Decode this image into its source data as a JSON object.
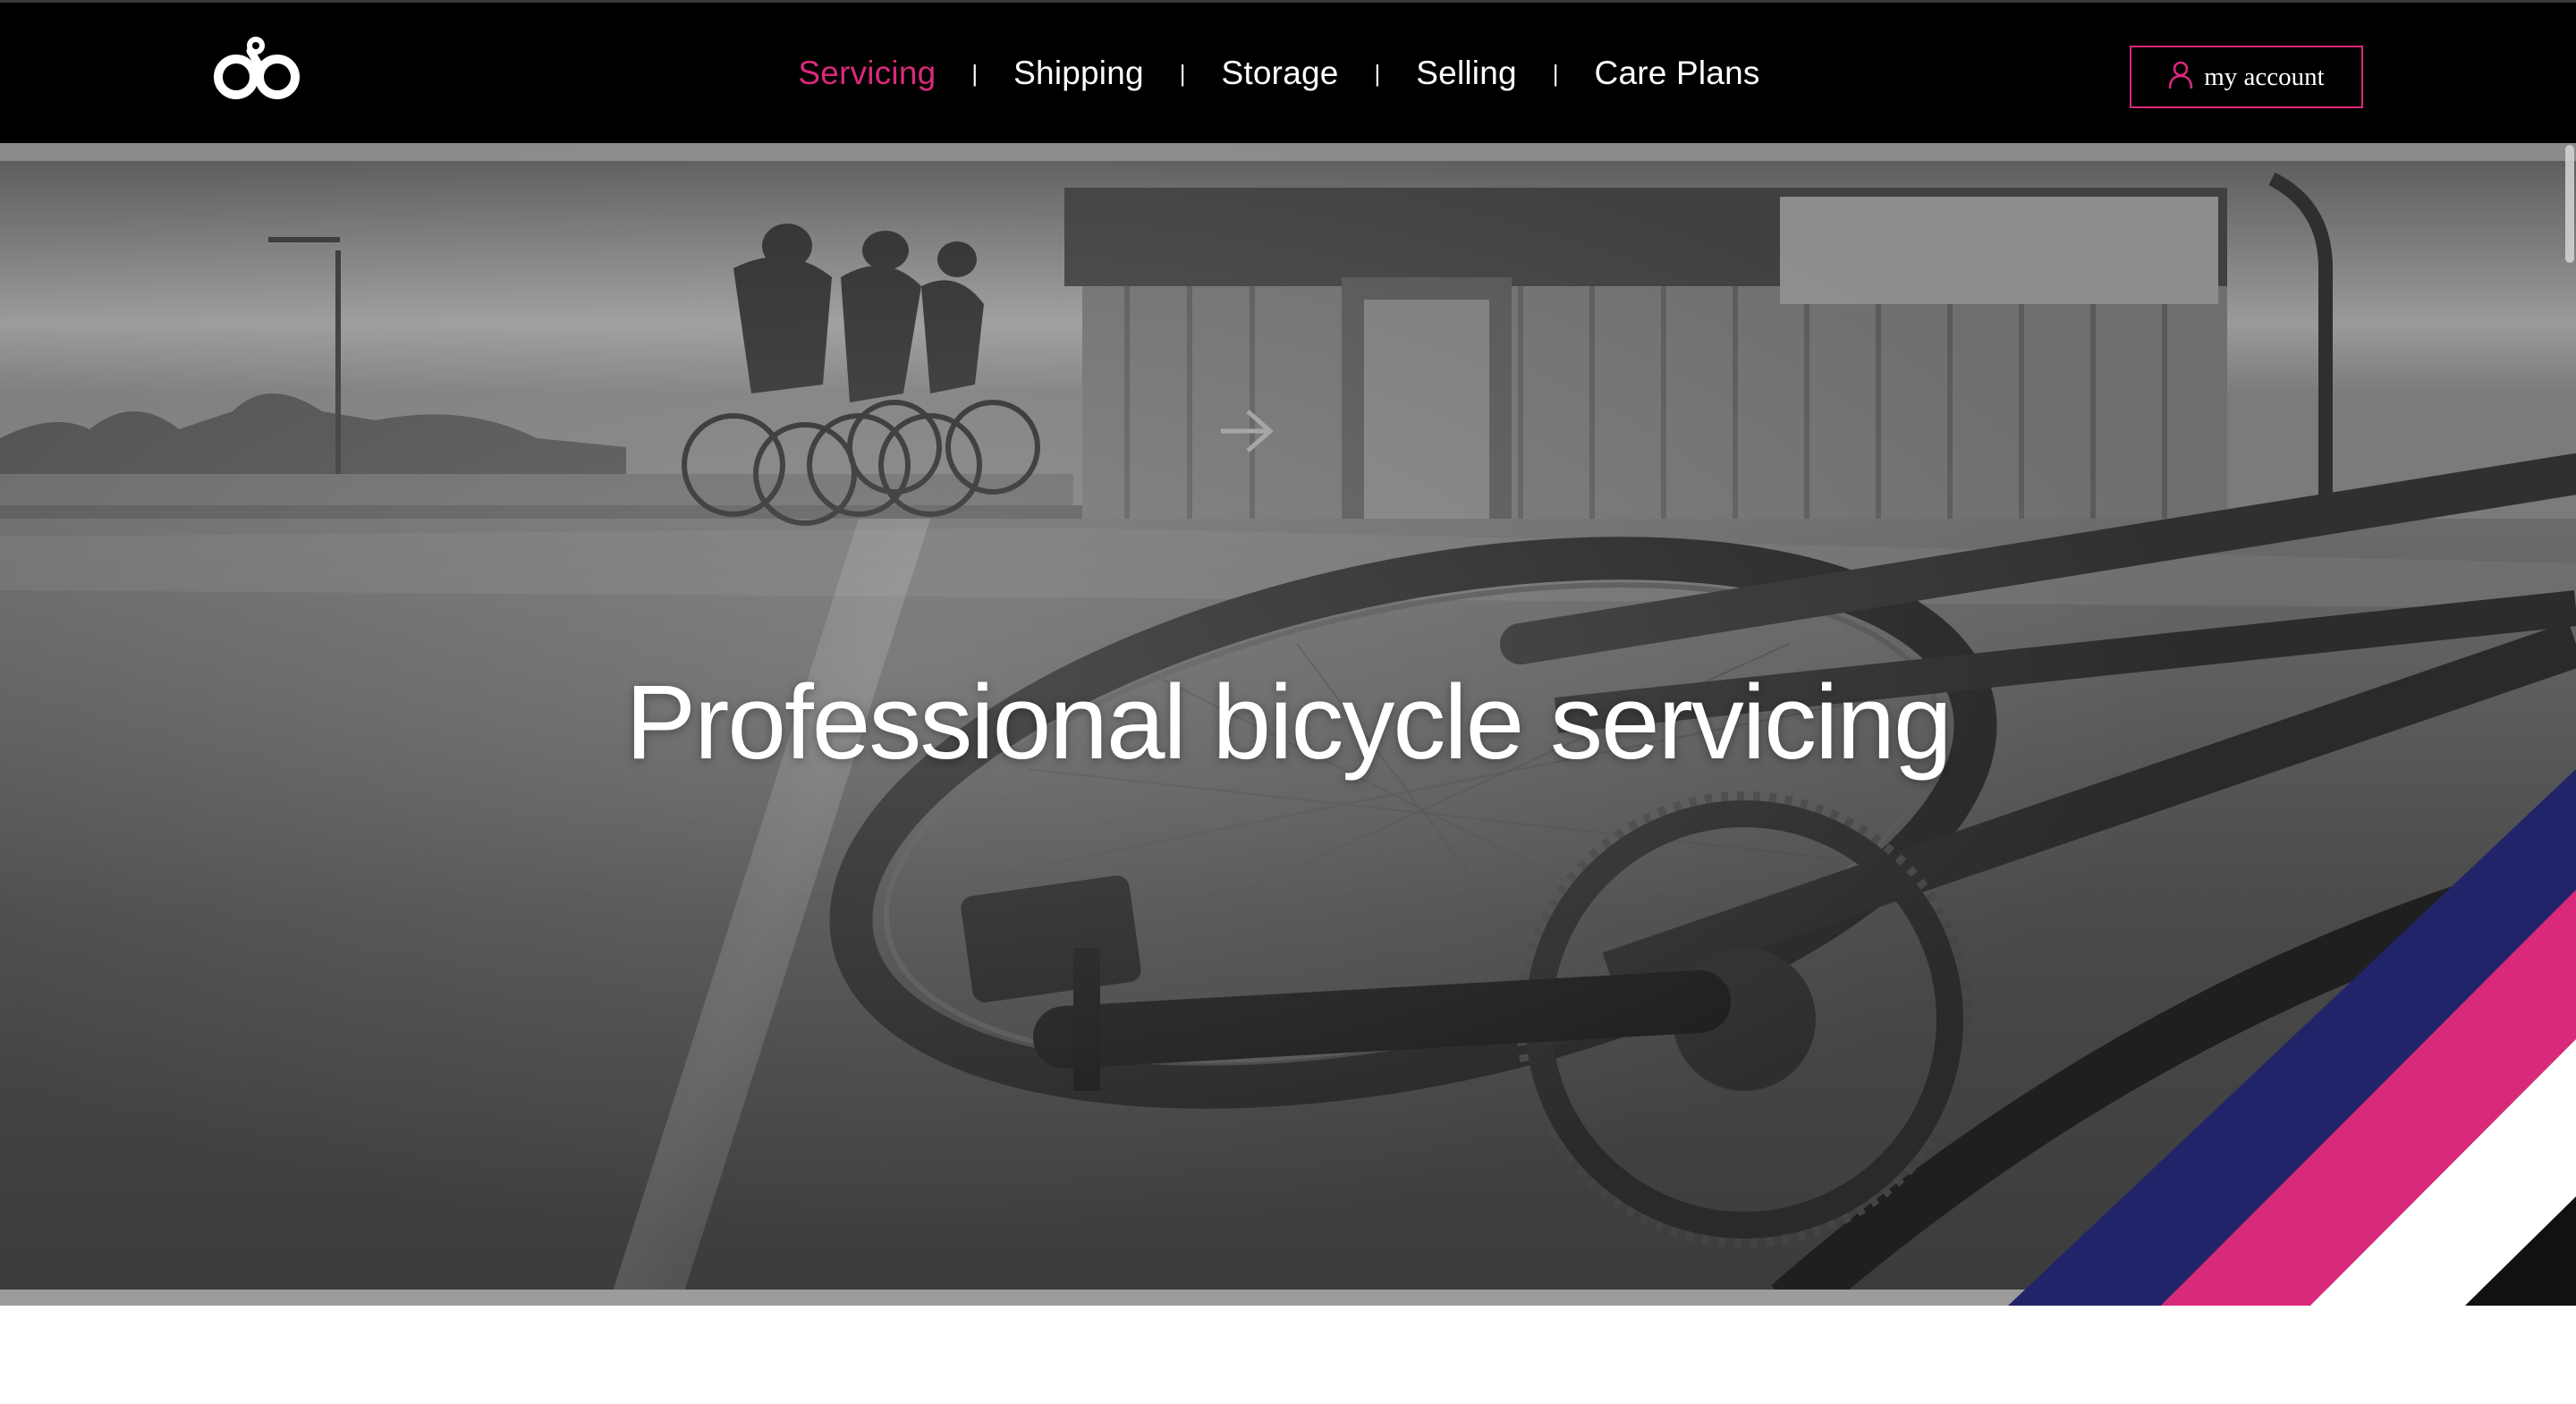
{
  "header": {
    "logo_icon": "ob-logo-icon",
    "nav": [
      {
        "label": "Servicing",
        "active": true
      },
      {
        "label": "Shipping",
        "active": false
      },
      {
        "label": "Storage",
        "active": false
      },
      {
        "label": "Selling",
        "active": false
      },
      {
        "label": "Care Plans",
        "active": false
      }
    ],
    "separator": "|",
    "account_label": "my account",
    "account_icon": "user-icon"
  },
  "hero": {
    "headline": "Professional bicycle servicing",
    "image": "black-and-white photo of a road bike lying on grass with cyclists riding past a wooden building",
    "stripe_colors": [
      "#22246a",
      "#d9297b",
      "#ffffff",
      "#111111"
    ]
  },
  "colors": {
    "accent": "#d9297b",
    "navy": "#22246a",
    "header_bg": "#000000"
  }
}
